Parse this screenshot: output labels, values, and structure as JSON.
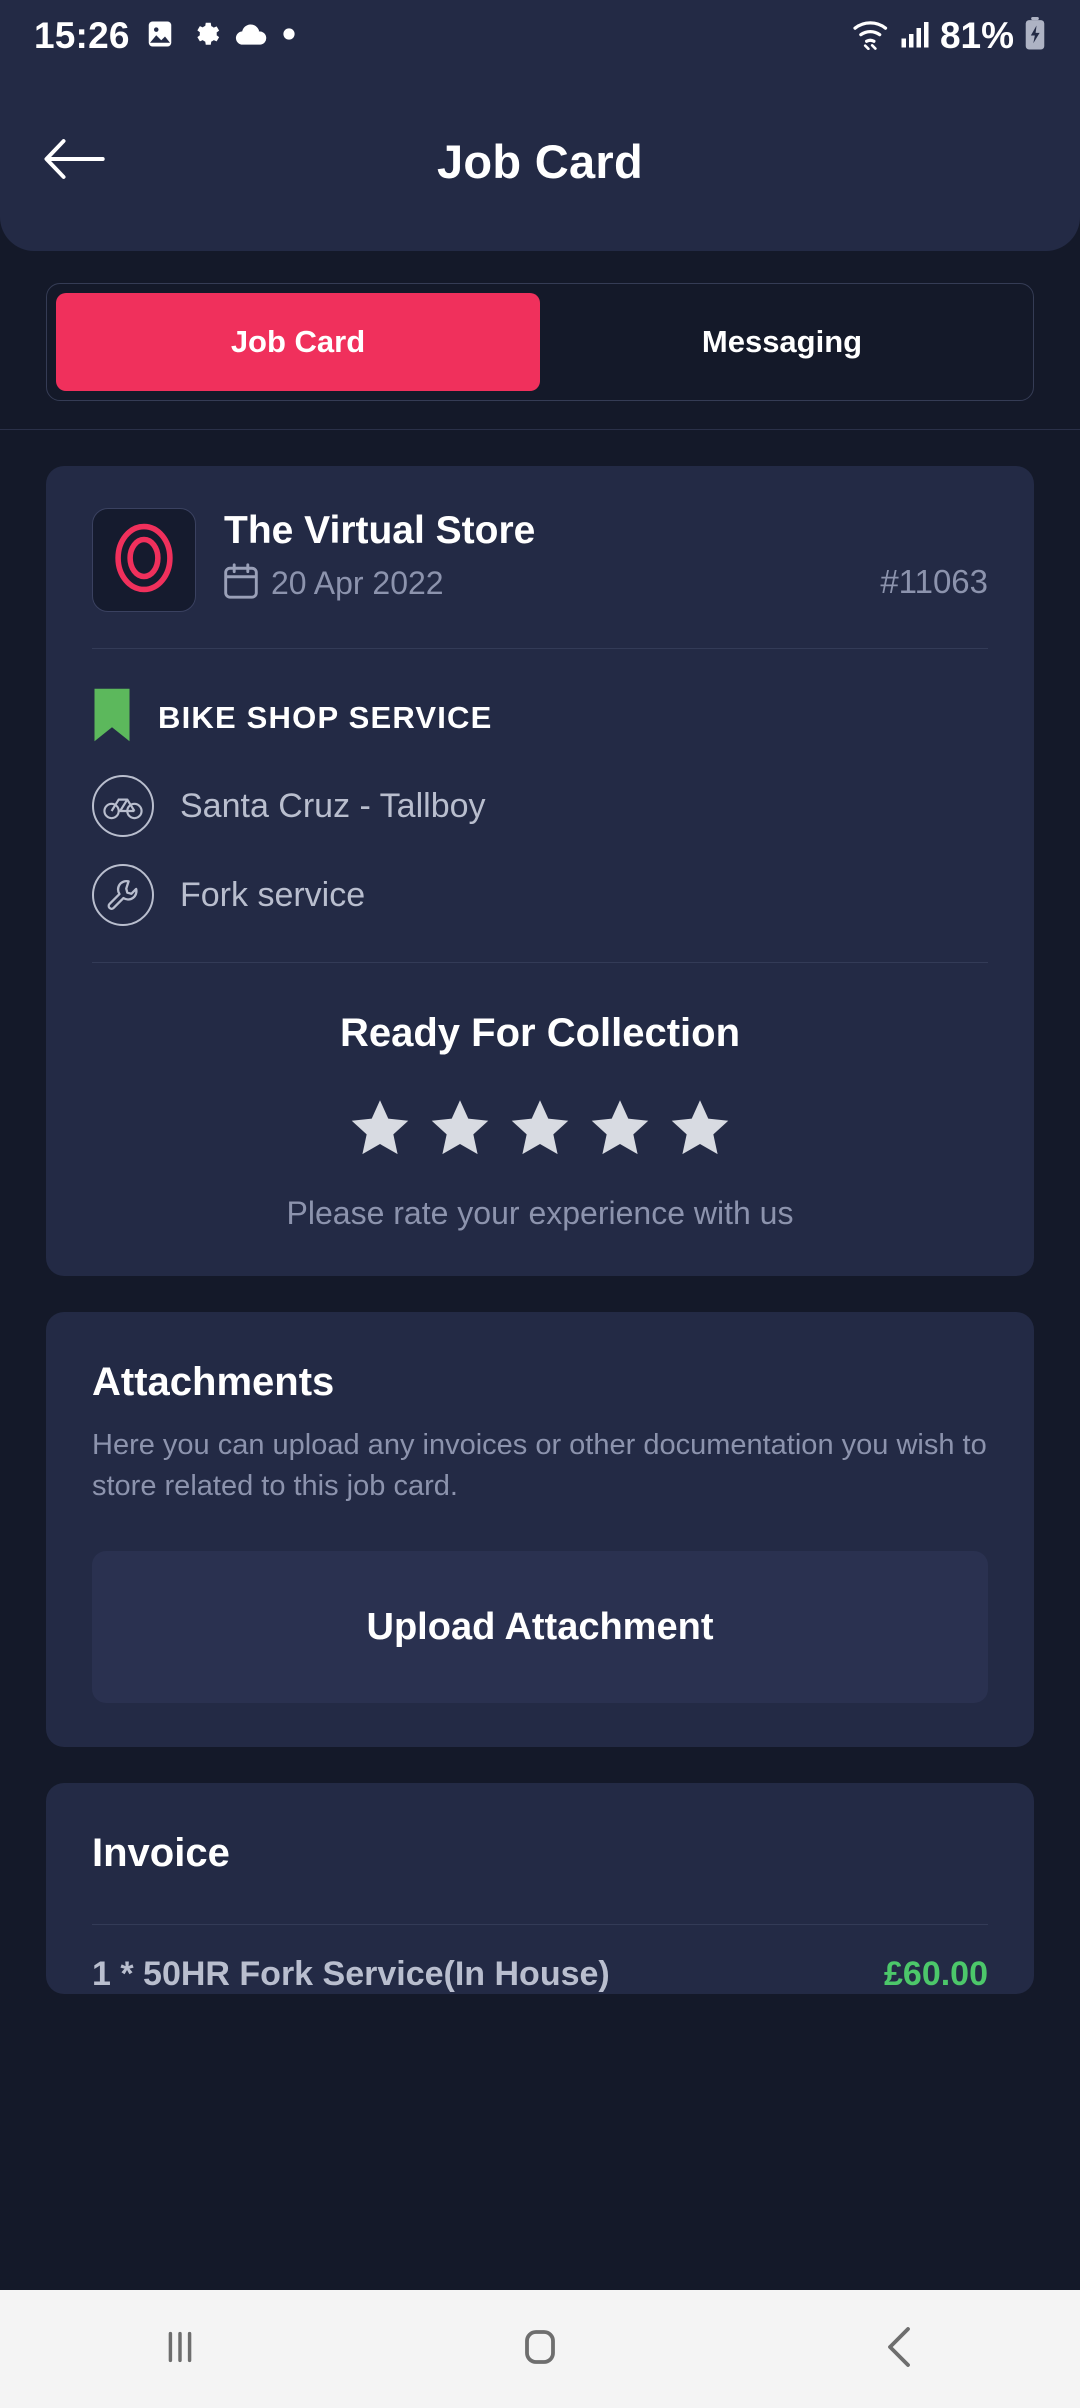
{
  "status_bar": {
    "time": "15:26",
    "battery": "81%",
    "icons": [
      "image-icon",
      "gear-icon",
      "cloud-icon",
      "dot-icon",
      "wifi-icon",
      "cellular-signal-icon",
      "battery-charging-icon"
    ]
  },
  "header": {
    "title": "Job Card",
    "back_icon": "back-arrow-icon"
  },
  "tabs": [
    {
      "label": "Job Card",
      "active": true
    },
    {
      "label": "Messaging",
      "active": false
    }
  ],
  "job_card": {
    "logo_icon": "store-logo-icon",
    "store_name": "The Virtual Store",
    "calendar_icon": "calendar-icon",
    "date": "20 Apr 2022",
    "job_number": "#11063",
    "service_flag_icon": "bookmark-icon",
    "service_category": "BIKE SHOP SERVICE",
    "rows": [
      {
        "icon": "bicycle-icon",
        "label": "Santa Cruz - Tallboy"
      },
      {
        "icon": "wrench-icon",
        "label": "Fork service"
      }
    ],
    "status": "Ready For Collection",
    "stars": 5,
    "rating_prompt": "Please rate your experience with us"
  },
  "attachments": {
    "title": "Attachments",
    "description": "Here you can upload any invoices or other documentation you wish to store related to this job card.",
    "upload_label": "Upload Attachment"
  },
  "invoice": {
    "title": "Invoice",
    "items": [
      {
        "description": "1 * 50HR Fork Service(In House)",
        "amount": "£60.00"
      }
    ]
  },
  "nav_bar": {
    "recents_icon": "recents-icon",
    "home_icon": "home-icon",
    "back_icon": "nav-back-icon"
  },
  "colors": {
    "accent": "#f0305c",
    "card": "#232a45",
    "background": "#141929",
    "muted_text": "#8c93ad",
    "green": "#4cc76a",
    "flag_green": "#5cb85c"
  }
}
